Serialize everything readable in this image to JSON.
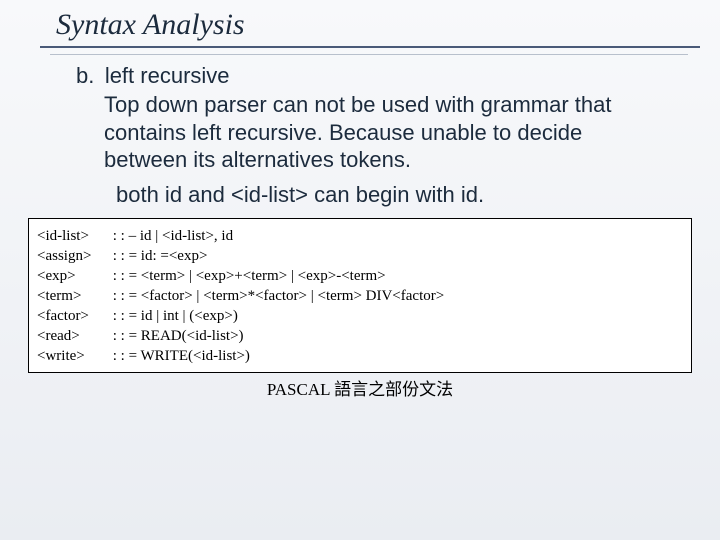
{
  "title": "Syntax Analysis",
  "section": {
    "label": "b.",
    "heading": "left recursive",
    "body": "Top down parser can not be used with grammar that contains left recursive. Because unable to decide between its alternatives tokens.",
    "note": "both id and <id-list> can begin with id."
  },
  "grammar": [
    {
      "left": "<id-list>",
      "right": ": : – id   |   <id-list>, id"
    },
    {
      "left": "<assign>",
      "right": ": : = id: =<exp>"
    },
    {
      "left": "<exp>",
      "right": ": : = <term>   |   <exp>+<term>   |   <exp>-<term>"
    },
    {
      "left": "<term>",
      "right": ": : = <factor> |   <term>*<factor>   |   <term> DIV<factor>"
    },
    {
      "left": "<factor>",
      "right": ": : = id   |   int   |   (<exp>)"
    },
    {
      "left": "<read>",
      "right": ": : = READ(<id-list>)"
    },
    {
      "left": "<write>",
      "right": ": : = WRITE(<id-list>)"
    }
  ],
  "caption": "PASCAL 語言之部份文法"
}
